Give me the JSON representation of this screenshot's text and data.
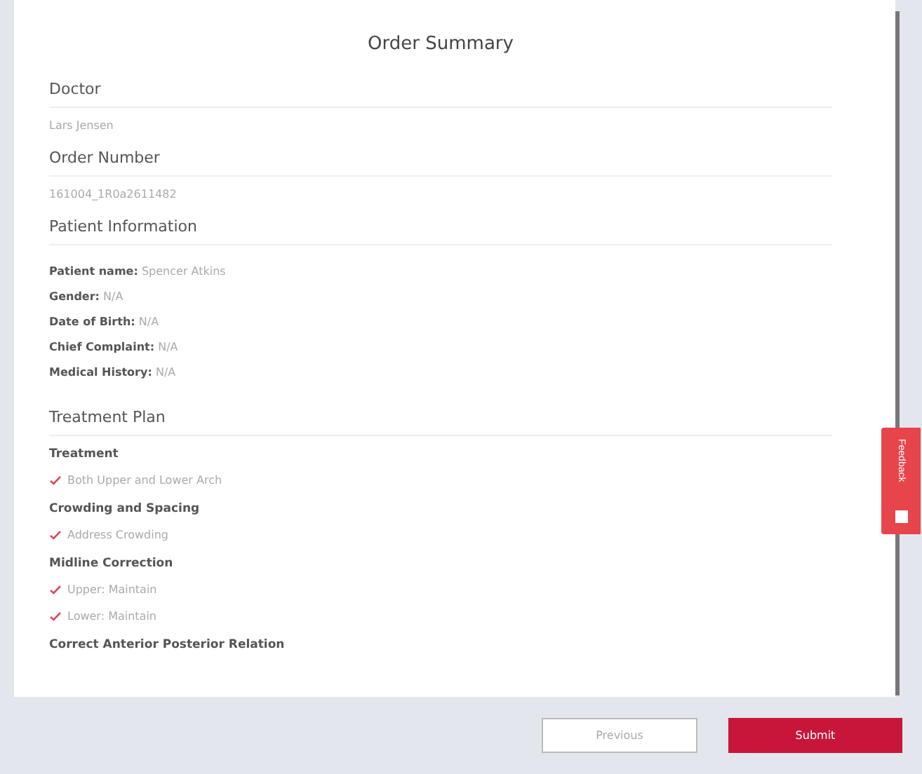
{
  "dialog": {
    "title": "Order Summary"
  },
  "sections": [
    {
      "kind": "value",
      "title": "Doctor",
      "value": "Lars Jensen"
    },
    {
      "kind": "value",
      "title": "Order Number",
      "value": "161004_1R0a2611482"
    },
    {
      "kind": "fields",
      "title": "Patient Information",
      "fields": [
        {
          "label": "Patient name:",
          "value": "Spencer Atkins"
        },
        {
          "label": "Gender:",
          "value": "N/A"
        },
        {
          "label": "Date of Birth:",
          "value": "N/A"
        },
        {
          "label": "Chief Complaint:",
          "value": "N/A"
        },
        {
          "label": "Medical History:",
          "value": "N/A"
        }
      ]
    },
    {
      "kind": "groups",
      "title": "Treatment Plan",
      "groups": [
        {
          "title": "Treatment",
          "items": [
            {
              "text": "Both Upper and Lower Arch",
              "checked": true
            }
          ]
        },
        {
          "title": "Crowding and Spacing",
          "items": [
            {
              "text": "Address Crowding",
              "checked": true
            }
          ]
        },
        {
          "title": "Midline Correction",
          "items": [
            {
              "text": "Upper: Maintain",
              "checked": true
            },
            {
              "text": "Lower: Maintain",
              "checked": true
            }
          ]
        },
        {
          "title": "Correct Anterior Posterior Relation"
        }
      ]
    }
  ],
  "feedback_tab": {
    "label": "Feedback"
  },
  "buttons": [
    {
      "kind": "secondary",
      "label": "Previous"
    },
    {
      "kind": "primary",
      "label": "Submit"
    }
  ]
}
